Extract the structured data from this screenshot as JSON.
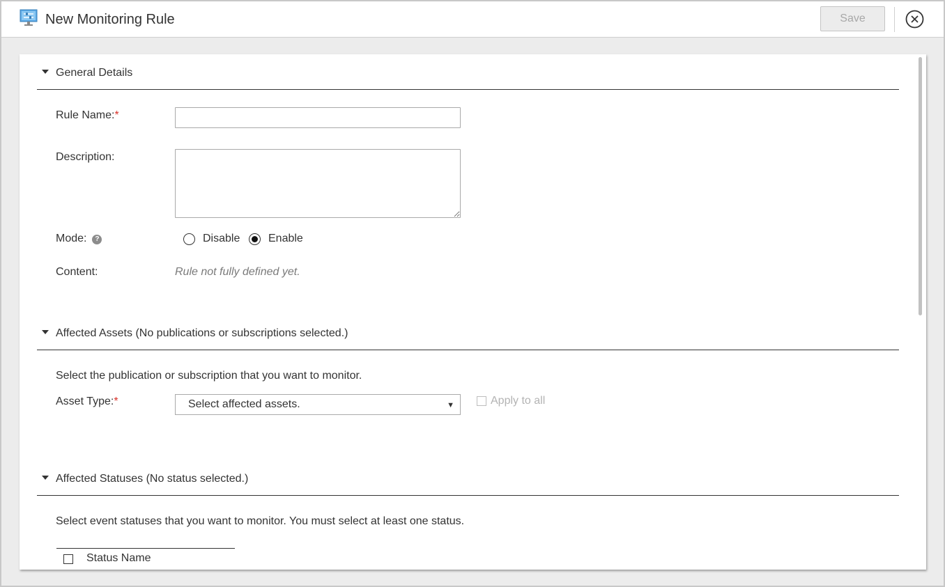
{
  "header": {
    "title": "New Monitoring Rule",
    "save_label": "Save",
    "app_icon": "monitor-settings-icon",
    "close_icon": "close-circle-icon"
  },
  "sections": {
    "general": {
      "title": "General Details",
      "rule_name_label": "Rule Name:",
      "required_mark": "*",
      "rule_name_value": "",
      "description_label": "Description:",
      "description_value": "",
      "mode_label": "Mode:",
      "mode_help": "?",
      "mode_options": [
        "Disable",
        "Enable"
      ],
      "mode_selected": "Enable",
      "content_label": "Content:",
      "content_value": "Rule not fully defined yet."
    },
    "assets": {
      "title": "Affected Assets (No publications or subscriptions selected.)",
      "instruction": "Select the publication or subscription that you want to monitor.",
      "asset_type_label": "Asset Type:",
      "required_mark": "*",
      "select_value": "Select affected assets.",
      "apply_all_label": "Apply to all"
    },
    "statuses": {
      "title": "Affected Statuses (No status selected.)",
      "instruction": "Select event statuses that you want to monitor. You must select at least one status.",
      "column_header": "Status Name"
    }
  },
  "colors": {
    "required": "#d9322a",
    "disabled_text": "#b3b3b3",
    "background": "#ececec"
  }
}
